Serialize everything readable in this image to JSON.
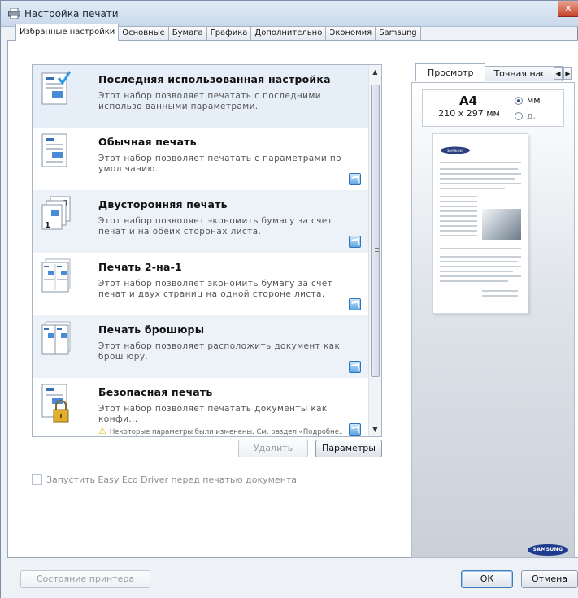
{
  "window": {
    "title": "Настройка печати",
    "close_label": "✕"
  },
  "tabs": [
    {
      "label": "Избранные настройки",
      "active": true
    },
    {
      "label": "Основные",
      "active": false
    },
    {
      "label": "Бумага",
      "active": false
    },
    {
      "label": "Графика",
      "active": false
    },
    {
      "label": "Дополнительно",
      "active": false
    },
    {
      "label": "Экономия",
      "active": false
    },
    {
      "label": "Samsung",
      "active": false
    }
  ],
  "presets": [
    {
      "name": "Последняя использованная настройка",
      "desc": "Этот набор позволяет печатать с последними использо ванными параметрами.",
      "icon": "last-settings-icon"
    },
    {
      "name": "Обычная печать",
      "desc": "Этот набор позволяет печатать с параметрами по умол чанию.",
      "icon": "normal-print-icon"
    },
    {
      "name": "Двусторонняя печать",
      "desc": "Этот набор позволяет экономить бумагу за счет печат и на обеих сторонах листа.",
      "icon": "duplex-print-icon"
    },
    {
      "name": "Печать 2-на-1",
      "desc": "Этот набор позволяет экономить бумагу за счет печат и двух страниц на одной стороне листа.",
      "icon": "two-up-print-icon"
    },
    {
      "name": "Печать брошюры",
      "desc": "Этот набор позволяет расположить документ как брош юру.",
      "icon": "booklet-print-icon"
    },
    {
      "name": "Безопасная печать",
      "desc": "Этот набор позволяет печатать документы как конфи...",
      "icon": "secure-print-icon",
      "warning": "Некоторые параметры были изменены. См. раздел «Подробне..."
    }
  ],
  "buttons": {
    "delete": "Удалить",
    "params": "Параметры",
    "printer_status": "Состояние принтера",
    "ok": "ОК",
    "cancel": "Отмена"
  },
  "eco_checkbox": {
    "label": "Запустить Easy Eco Driver перед печатью документа",
    "checked": false
  },
  "preview": {
    "tabs": [
      {
        "label": "Просмотр",
        "active": true
      },
      {
        "label": "Точная нас",
        "active": false
      }
    ],
    "paper_size": "A4",
    "paper_dimensions": "210 x 297 мм",
    "units": [
      {
        "label": "мм",
        "selected": true
      },
      {
        "label": "д.",
        "selected": false
      }
    ],
    "logo_text": "SAMSUNG",
    "page_logo_text": "SAMSUNG"
  },
  "colors": {
    "accent": "#3d7bbf",
    "close": "#c8432b",
    "brand": "#1e3c8e"
  }
}
